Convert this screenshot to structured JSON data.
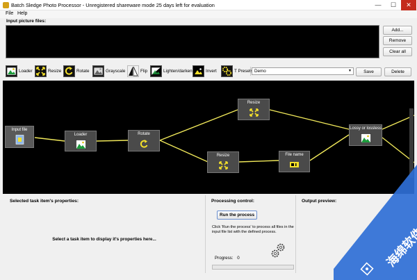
{
  "window": {
    "title": "Batch Sledge Photo Processor - Unregistered shareware mode 25 days left for evaluation",
    "min_glyph": "—",
    "max_glyph": "☐",
    "close_glyph": "✕"
  },
  "menu": {
    "items": [
      "File",
      "Help"
    ]
  },
  "input_files": {
    "label": "Input picture files:",
    "add_label": "Add...",
    "remove_label": "Remove",
    "clear_label": "Clear all"
  },
  "toolbar": {
    "tools": [
      {
        "label": "Loader",
        "icon": "loader-icon"
      },
      {
        "label": "Resize",
        "icon": "resize-icon"
      },
      {
        "label": "Rotate",
        "icon": "rotate-icon"
      },
      {
        "label": "Grayscale",
        "icon": "grayscale-icon"
      },
      {
        "label": "Flip",
        "icon": "flip-icon"
      },
      {
        "label": "Lighten/darken",
        "icon": "lighten-darken-icon"
      },
      {
        "label": "Invert",
        "icon": "invert-icon"
      }
    ],
    "presets_label": "T Presets:",
    "preset_value": "Demo",
    "save_label": "Save",
    "delete_label": "Delete"
  },
  "graph": {
    "nodes": [
      {
        "label": "Input file",
        "icon": "input-file-icon"
      },
      {
        "label": "Loader",
        "icon": "loader-icon"
      },
      {
        "label": "Rotate",
        "icon": "rotate-icon"
      },
      {
        "label": "Resize",
        "icon": "resize-icon"
      },
      {
        "label": "Resize",
        "icon": "resize-icon"
      },
      {
        "label": "File name",
        "icon": "file-name-icon"
      },
      {
        "label": "Lossy or lossless",
        "icon": "lossy-lossless-icon"
      }
    ],
    "edge_color": "#f0e85a"
  },
  "properties": {
    "label": "Selected task item's properties:",
    "hint": "Select a task item to display it's properties here..."
  },
  "processing": {
    "label": "Processing control:",
    "run_label": "Run the process",
    "description": "Click 'Run the process' to process all files in the input file list with the defined process.",
    "progress_label": "Progress:",
    "progress_value": "0",
    "progress_fraction": 0
  },
  "preview": {
    "label": "Output preview:"
  },
  "watermark": {
    "text": "海绵软件"
  },
  "colors": {
    "accent": "#f0e85a",
    "canvas": "#000000",
    "node": "#4a4a4a",
    "watermark": "#2f6fd6"
  }
}
